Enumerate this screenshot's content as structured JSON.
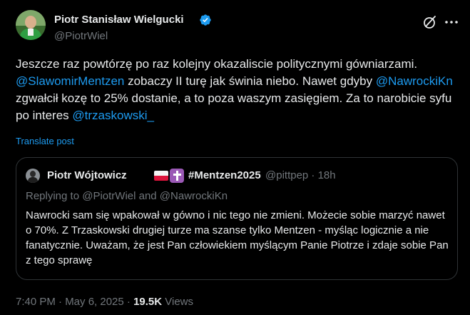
{
  "author": {
    "name": "Piotr Stanisław Wielgucki",
    "handle": "@PiotrWiel",
    "verified": true
  },
  "post": {
    "text_1": "Jeszcze raz powtórzę po raz kolejny okazaliscie politycznymi gówniarzami. ",
    "mention_1": "@SlawomirMentzen",
    "text_2": " zobaczy II turę jak świnia niebo. Nawet gdyby ",
    "mention_2": "@NawrockiKn",
    "text_3": " zgwałcił kozę to 25% dostanie, a to poza waszym zasięgiem. Za to narobicie syfu po interes ",
    "mention_3": "@trzaskowski_",
    "translate_label": "Translate post"
  },
  "quote": {
    "name": "Piotr Wójtowicz",
    "tag": "#Mentzen2025",
    "handle_time": "@pittpep · 18h",
    "reply_to": "Replying to @PiotrWiel and @NawrockiKn",
    "text": "Nawrocki sam się wpakował w gówno i nic tego nie zmieni. Możecie sobie marzyć nawet o 70%. Z Trzaskowski drugiej turze ma szanse tylko Mentzen - myśląc logicznie a nie fanatycznie. Uważam, że jest Pan człowiekiem myślącym Panie Piotrze i zdaje sobie Pan z tego sprawę"
  },
  "meta": {
    "timestamp": "7:40 PM · May 6, 2025 · ",
    "views_count": "19.5K",
    "views_label": " Views"
  },
  "icons": {
    "verified": "verified-badge-icon",
    "grok": "grok-icon",
    "more": "more-options-icon"
  },
  "colors": {
    "background": "#000000",
    "text": "#e7e9ea",
    "secondary": "#71767b",
    "link": "#1d9bf0",
    "border": "#2f3336"
  }
}
